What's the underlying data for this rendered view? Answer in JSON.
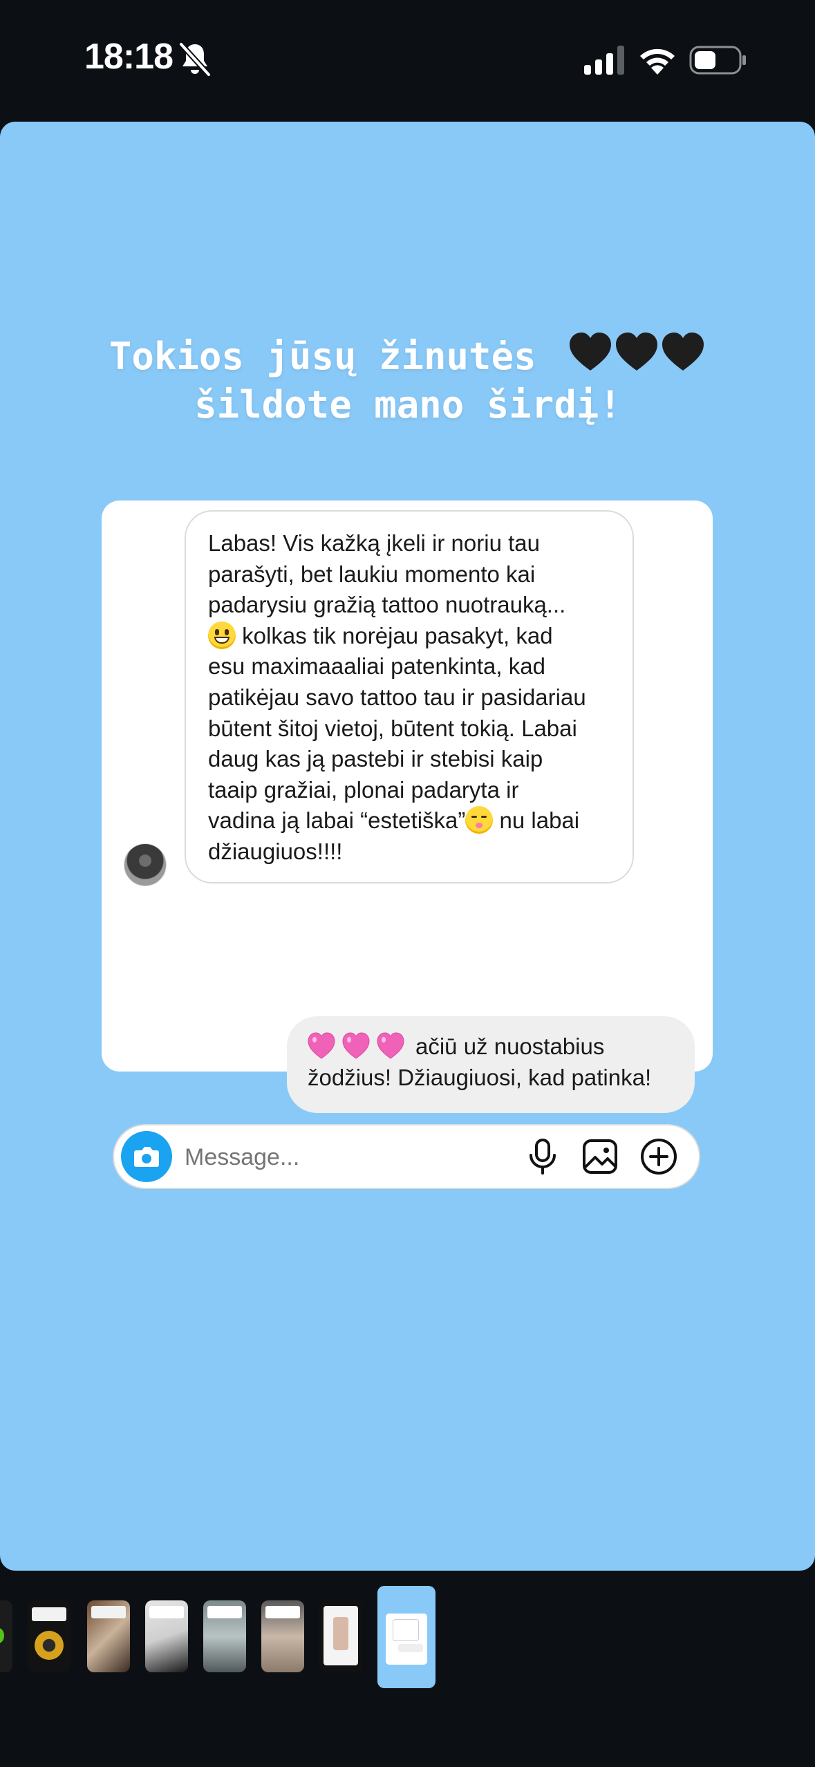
{
  "status_bar": {
    "time": "18:18",
    "icons": [
      "bell-slash-icon",
      "signal-icon",
      "wifi-icon",
      "battery-icon"
    ]
  },
  "story": {
    "background_color": "#89c9f7",
    "caption_line1": "Tokios jūsų žinutės",
    "caption_line2": "šildote mano širdį!",
    "caption_emoji": "black-hearts-icon"
  },
  "chat": {
    "received_lines": [
      "Labas! Vis kažką įkeli ir noriu tau",
      "parašyti, bet laukiu momento kai",
      "padarysiu gražią tattoo nuotrauką...",
      "kolkas tik norėjau pasakyt, kad",
      "esu maximaaaliai patenkinta, kad",
      "patikėjau savo tattoo tau ir pasidariau",
      "būtent šitoj vietoj, būtent tokią. Labai",
      "daug kas ją pastebi ir stebisi kaip",
      "taaip gražiai, plonai padaryta ir",
      "vadina ją labai “estetiška”",
      "nu labai",
      "džiaugiuos!!!!"
    ],
    "sent_line1": "ačiū už nuostabius",
    "sent_line2": "žodžius! Džiaugiuosi, kad patinka!",
    "sent_emoji": "pink-hearts-icon",
    "message_placeholder": "Message...",
    "composer_icons": [
      "camera-icon",
      "microphone-icon",
      "gallery-icon",
      "plus-icon"
    ]
  },
  "story_tray": {
    "thumbnail_count": 8,
    "active_index": 7
  }
}
